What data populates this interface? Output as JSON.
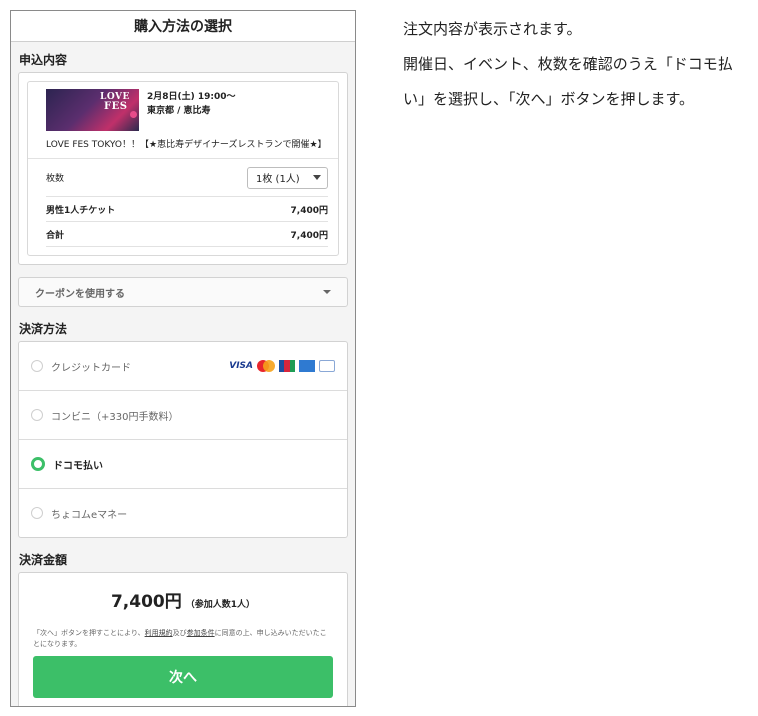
{
  "screen": {
    "title": "購入方法の選択",
    "order_section": "申込内容",
    "event": {
      "thumb_line1": "LOVE",
      "thumb_line2": "FES",
      "datetime": "2月8日(土) 19:00〜",
      "place": "東京都 / 恵比寿",
      "name": "LOVE FES TOKYO！！【★恵比寿デザイナーズレストランで開催★】"
    },
    "quantity": {
      "label": "枚数",
      "selected": "1枚 (1人)"
    },
    "ticket": {
      "label": "男性1人チケット",
      "price": "7,400円"
    },
    "total": {
      "label": "合計",
      "price": "7,400円"
    },
    "coupon_label": "クーポンを使用する",
    "payment_section": "決済方法",
    "payments": [
      {
        "label": "クレジットカード",
        "selected": false
      },
      {
        "label": "コンビニ（+330円手数料）",
        "selected": false
      },
      {
        "label": "ドコモ払い",
        "selected": true
      },
      {
        "label": "ちょコムeマネー",
        "selected": false
      }
    ],
    "card_brands": {
      "visa": "VISA"
    },
    "amount_section": "決済金額",
    "amount": {
      "value": "7,400円",
      "note": "（参加人数1人）"
    },
    "notice": {
      "prefix": "「次へ」ボタンを押すことにより、",
      "terms": "利用規約",
      "mid": "及び",
      "conditions": "参加条件",
      "suffix": "に同意の上、申し込みいただいたことになります。"
    },
    "next_label": "次へ"
  },
  "explanation": {
    "line1": "注文内容が表示されます。",
    "line2": "開催日、イベント、枚数を確認のうえ「ドコモ払い」を選択し、「次へ」ボタンを押します。"
  },
  "colors": {
    "accent": "#3cbf68"
  }
}
